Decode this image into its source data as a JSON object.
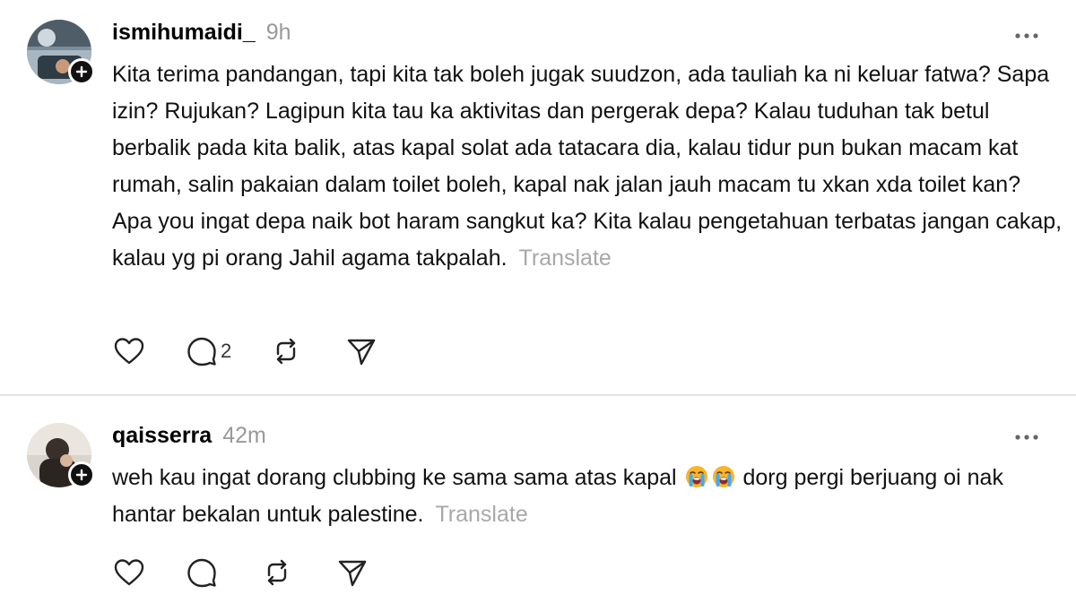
{
  "posts": [
    {
      "username": "ismihumaidi_",
      "time": "9h",
      "text": "Kita terima pandangan, tapi kita tak boleh jugak suudzon, ada tauliah ka ni keluar fatwa? Sapa izin? Rujukan? Lagipun kita tau ka aktivitas dan pergerak depa? Kalau tuduhan tak betul berbalik pada kita balik, atas kapal solat ada tatacara dia, kalau tidur pun bukan macam kat rumah, salin pakaian dalam toilet boleh, kapal nak jalan jauh macam tu xkan xda toilet kan? Apa you ingat depa naik bot haram sangkut ka? Kita kalau pengetahuan terbatas jangan cakap, kalau yg pi orang Jahil agama takpalah.",
      "translate": "Translate",
      "reply_count": "2"
    },
    {
      "username": "qaisserra",
      "time": "42m",
      "text_before_emoji": "weh kau ingat dorang clubbing ke sama sama atas kapal",
      "text_after_emoji": "dorg pergi berjuang oi nak hantar bekalan untuk palestine.",
      "translate": "Translate",
      "emoji_names": [
        "loudly-crying-face-emoji",
        "loudly-crying-face-emoji"
      ]
    }
  ],
  "icons": {
    "follow": "plus-icon",
    "more": "more-horizontal-icon",
    "like": "heart-icon",
    "reply": "comment-icon",
    "repost": "repost-icon",
    "share": "send-icon"
  },
  "colors": {
    "text": "#111111",
    "muted": "#999999",
    "translate": "#a8a8a8",
    "divider": "#e3e3e3"
  }
}
